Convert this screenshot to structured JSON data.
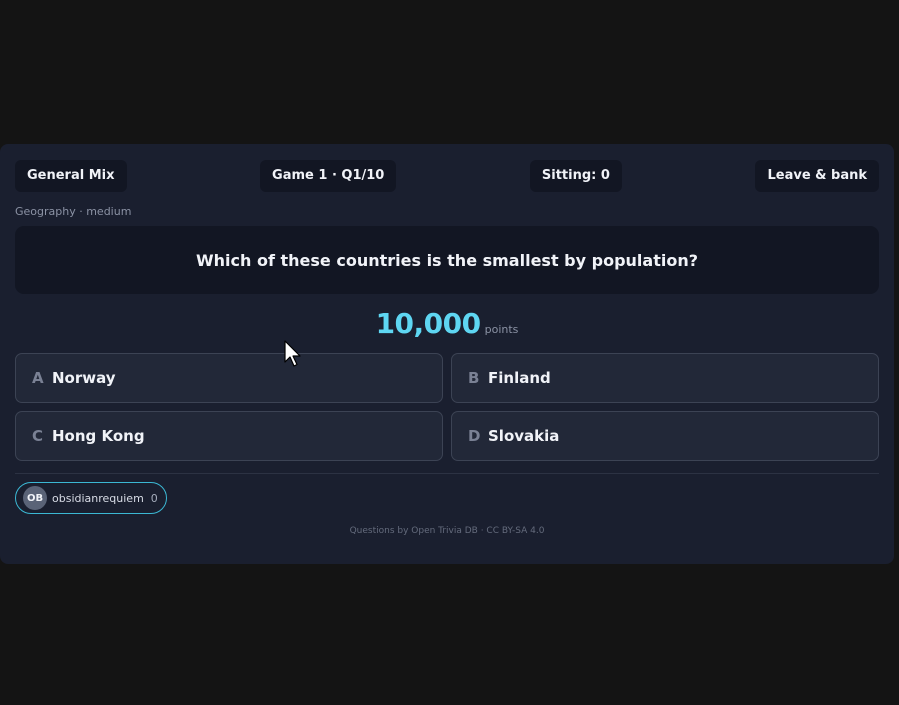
{
  "header": {
    "category_chip": "General Mix",
    "game_progress": "Game 1 · Q1/10",
    "sitting": "Sitting: 0",
    "leave_button": "Leave & bank"
  },
  "question": {
    "meta": "Geography · medium",
    "text": "Which of these countries is the smallest by population?",
    "points_value": "10,000",
    "points_label": "points"
  },
  "answers": [
    {
      "letter": "A",
      "text": "Norway"
    },
    {
      "letter": "B",
      "text": "Finland"
    },
    {
      "letter": "C",
      "text": "Hong Kong"
    },
    {
      "letter": "D",
      "text": "Slovakia"
    }
  ],
  "players": [
    {
      "initials": "OB",
      "name": "obsidianrequiem",
      "score": "0"
    }
  ],
  "footer": {
    "attribution": "Questions by Open Trivia DB · CC BY-SA 4.0"
  },
  "colors": {
    "accent": "#5ed6f2",
    "player_border": "#3bb8d4"
  }
}
